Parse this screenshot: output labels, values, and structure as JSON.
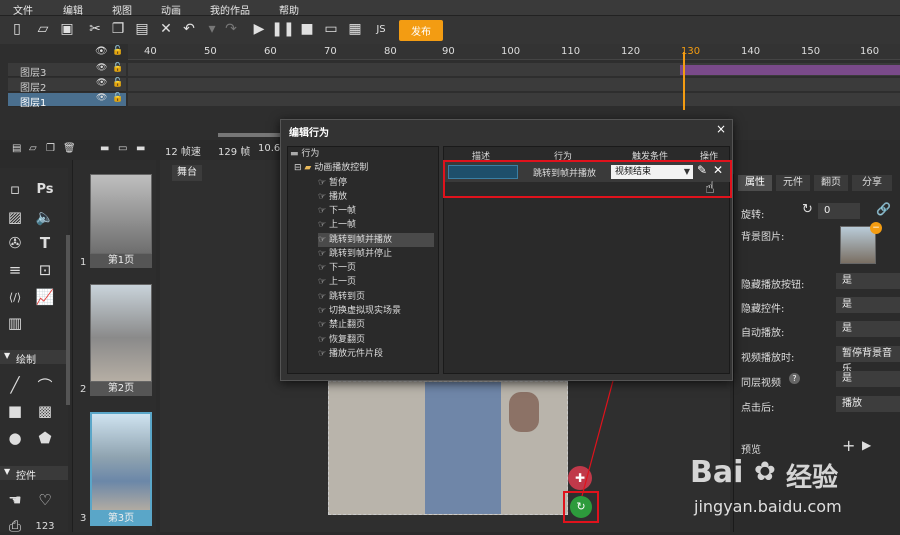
{
  "menubar": {
    "items": [
      "文件",
      "编辑",
      "视图",
      "动画",
      "我的作品",
      "帮助"
    ]
  },
  "toolbar": {
    "publish_label": "发布"
  },
  "timeline": {
    "ruler": [
      "40",
      "50",
      "60",
      "70",
      "80",
      "90",
      "100",
      "110",
      "120",
      "130",
      "140",
      "150",
      "160"
    ],
    "layers": [
      {
        "name": "图层3",
        "selected": false
      },
      {
        "name": "图层2",
        "selected": false
      },
      {
        "name": "图层1",
        "selected": true
      }
    ],
    "status": {
      "speed": "12 帧速",
      "frames": "129 帧",
      "time": "10.6"
    }
  },
  "left_panel": {
    "section_draw": "绘制",
    "section_controls": "控件",
    "ps_label": "Ps",
    "t_label": "T",
    "num_label": "123"
  },
  "pages": [
    {
      "num": "1",
      "label": "第1页",
      "selected": false
    },
    {
      "num": "2",
      "label": "第2页",
      "selected": false
    },
    {
      "num": "3",
      "label": "第3页",
      "selected": true
    }
  ],
  "stage": {
    "tab": "舞台"
  },
  "dialog": {
    "title": "编辑行为",
    "close": "×",
    "tree": {
      "root": "行为",
      "group": "动画播放控制",
      "items": [
        "暂停",
        "播放",
        "下一帧",
        "上一帧",
        "跳转到帧并播放",
        "跳转到帧并停止",
        "下一页",
        "上一页",
        "跳转到页",
        "切换虚拟现实场景",
        "禁止翻页",
        "恢复翻页",
        "播放元件片段"
      ],
      "selected_index": 4
    },
    "table": {
      "headers": [
        "描述",
        "行为",
        "触发条件",
        "操作"
      ],
      "row": {
        "description": "",
        "action": "跳转到帧并播放",
        "trigger": "视频结束"
      }
    }
  },
  "right_panel": {
    "tabs": [
      "属性",
      "元件",
      "翻页",
      "分享"
    ],
    "rotation_label": "旋转:",
    "rotation_value": "0",
    "bg_image_label": "背景图片:",
    "props": [
      {
        "label": "隐藏播放按钮:",
        "value": "是"
      },
      {
        "label": "隐藏控件:",
        "value": "是"
      },
      {
        "label": "自动播放:",
        "value": "是"
      },
      {
        "label": "视频播放时:",
        "value": "暂停背景音乐"
      },
      {
        "label": "同层视频",
        "value": "是"
      },
      {
        "label": "点击后:",
        "value": "播放"
      }
    ],
    "preview_label": "预览"
  },
  "watermark": {
    "brand": "Bai",
    "brand2": "经验",
    "url": "jingyan.baidu.com"
  },
  "colors": {
    "accent_orange": "#f39c12",
    "selection_blue": "#4a6f8e",
    "highlight_red": "#e0121c",
    "page_sel": "#5aa6c8"
  }
}
